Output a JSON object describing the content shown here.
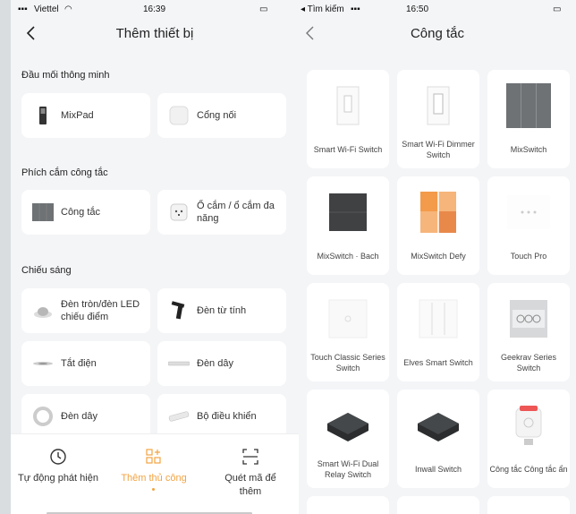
{
  "left": {
    "status": {
      "carrier": "Viettel",
      "time": "16:39"
    },
    "title": "Thêm thiết bị",
    "sections": [
      {
        "title": "Đầu mối thông minh",
        "items": [
          {
            "label": "MixPad",
            "icon": "mixpad-icon"
          },
          {
            "label": "Cổng nối",
            "icon": "gateway-icon"
          }
        ]
      },
      {
        "title": "Phích cắm công tắc",
        "items": [
          {
            "label": "Công tắc",
            "icon": "switch-icon"
          },
          {
            "label": "Ổ cắm / ổ cắm đa năng",
            "icon": "socket-icon"
          }
        ]
      },
      {
        "title": "Chiếu sáng",
        "items": [
          {
            "label": "Đèn tròn/đèn LED chiếu điểm",
            "icon": "downlight-icon"
          },
          {
            "label": "Đèn từ tính",
            "icon": "magnetic-light-icon"
          },
          {
            "label": "Tắt điện",
            "icon": "light-off-icon"
          },
          {
            "label": "Đèn dây",
            "icon": "strip-light-icon"
          },
          {
            "label": "Đèn dây",
            "icon": "ring-light-icon"
          },
          {
            "label": "Bộ điều khiển",
            "icon": "controller-icon"
          }
        ]
      }
    ],
    "tabs": [
      {
        "label": "Tự động phát hiện",
        "icon": "auto-detect-icon"
      },
      {
        "label": "Thêm thủ công",
        "icon": "manual-add-icon",
        "active": true
      },
      {
        "label": "Quét mã để thêm",
        "icon": "scan-icon"
      }
    ],
    "accent": "#f2a341"
  },
  "right": {
    "status": {
      "carrier": "◂ Tìm kiếm",
      "time": "16:50"
    },
    "title": "Công tắc",
    "items": [
      {
        "label": "Smart Wi-Fi Switch"
      },
      {
        "label": "Smart Wi-Fi Dimmer Switch"
      },
      {
        "label": "MixSwitch"
      },
      {
        "label": "MixSwitch · Bach"
      },
      {
        "label": "MixSwitch Defy"
      },
      {
        "label": "Touch Pro"
      },
      {
        "label": "Touch Classic Series Switch"
      },
      {
        "label": "Elves Smart Switch"
      },
      {
        "label": "Geekrav Series Switch"
      },
      {
        "label": "Smart Wi-Fi Dual Relay Switch"
      },
      {
        "label": "Inwall Switch"
      },
      {
        "label": "Công tắc Công tắc ẩn"
      }
    ]
  }
}
